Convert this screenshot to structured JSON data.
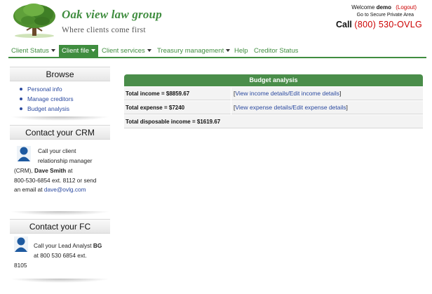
{
  "brand": {
    "title": "Oak view law group",
    "tagline": "Where clients come first",
    "accent_color": "#3f8d3f"
  },
  "header": {
    "welcome_prefix": "Welcome",
    "username": "demo",
    "logout": "(Logout)",
    "secure_link": "Go to Secure Private Area",
    "call_label": "Call",
    "phone": "(800) 530-OVLG"
  },
  "nav": {
    "items": [
      {
        "label": "Client Status",
        "has_dropdown": true
      },
      {
        "label": "Client file",
        "has_dropdown": true,
        "active": true
      },
      {
        "label": "Client services",
        "has_dropdown": true
      },
      {
        "label": "Treasury management",
        "has_dropdown": true
      },
      {
        "label": "Help",
        "has_dropdown": false
      },
      {
        "label": "Creditor Status",
        "has_dropdown": false
      }
    ]
  },
  "sidebar": {
    "browse": {
      "title": "Browse",
      "links": [
        "Personal info",
        "Manage creditors",
        "Budget analysis"
      ]
    },
    "crm": {
      "title": "Contact your CRM",
      "line1": "Call your client",
      "line2": "relationship manager",
      "line3_pre": "(CRM), ",
      "name": "Dave Smith",
      "line3_post": " at",
      "line4": "800-530-6854 ext. 8112 or send",
      "line5_pre": "an email at ",
      "email": "dave@ovlg.com"
    },
    "fc": {
      "title": "Contact your FC",
      "line1_pre": "Call your Lead Analyst ",
      "name": "BG",
      "line2": "at 800 530 6854 ext.",
      "line3": "8105"
    }
  },
  "budget": {
    "title": "Budget analysis",
    "rows": [
      {
        "label": "Total income = $8859.67",
        "link_pre": "[",
        "link": "View income details/Edit income details",
        "link_post": "]"
      },
      {
        "label": "Total expense = $7240",
        "link_pre": "[",
        "link": "View expense details/Edit expense details",
        "link_post": "]"
      },
      {
        "label": "Total disposable income = $1619.67"
      }
    ]
  }
}
